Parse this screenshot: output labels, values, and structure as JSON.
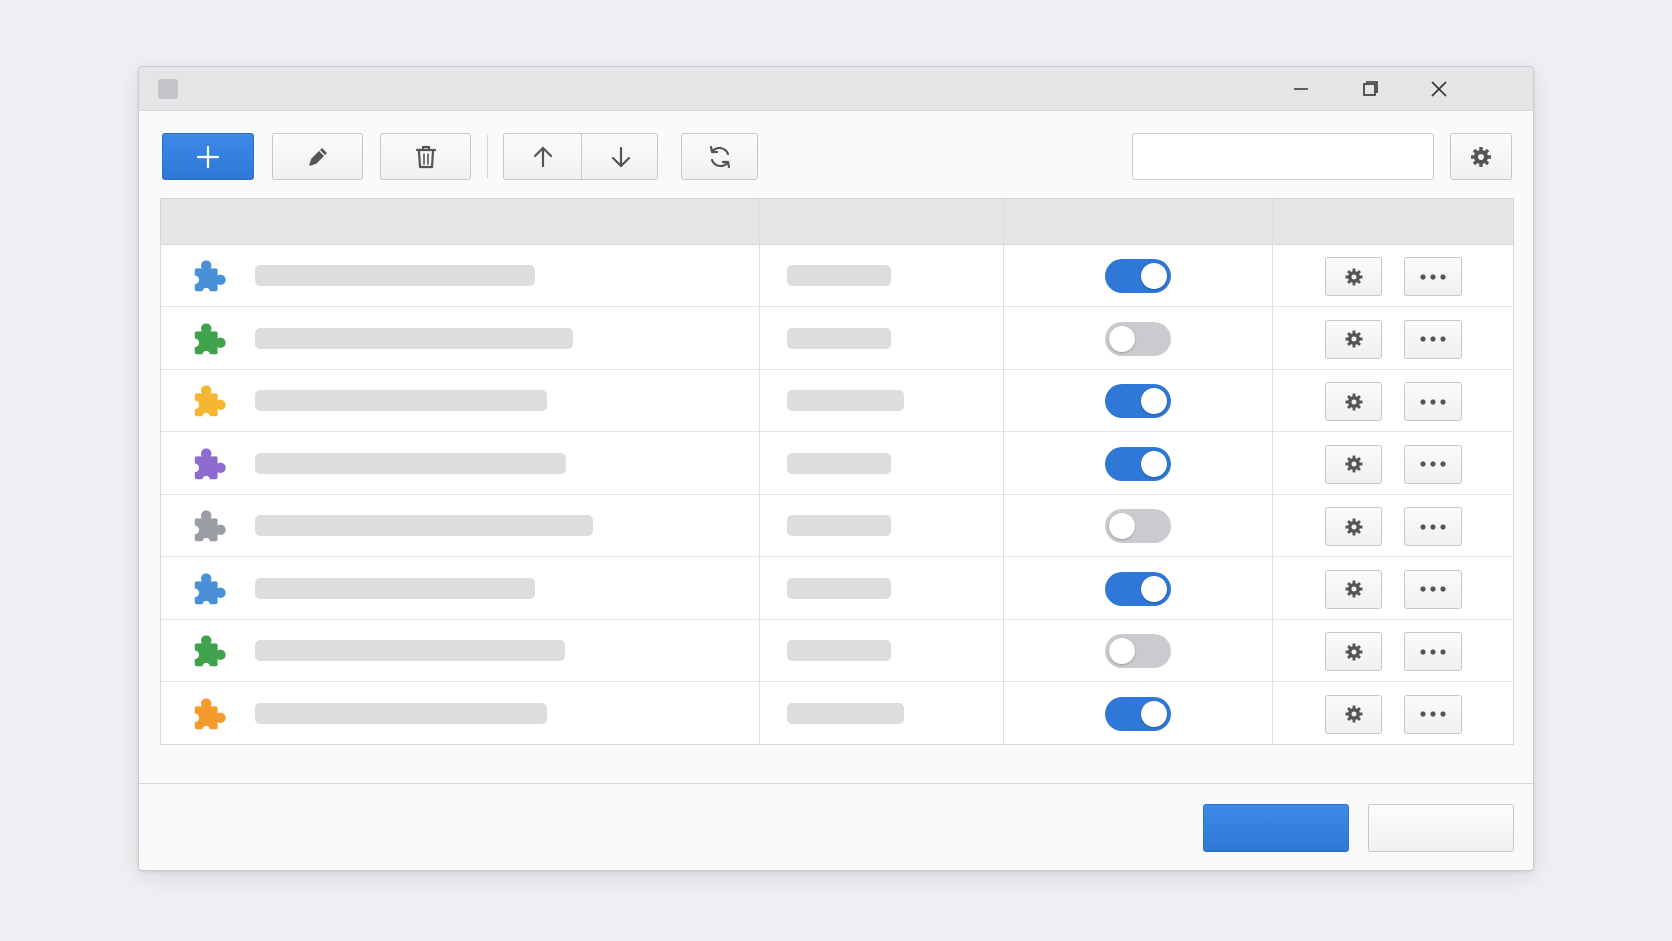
{
  "window": {
    "title": ""
  },
  "toolbar": {
    "search": {
      "value": "",
      "placeholder": ""
    }
  },
  "table": {
    "columns": [
      "",
      "",
      "",
      ""
    ],
    "rows": [
      {
        "icon": "puzzle-icon",
        "icon_color": "#4a90d9",
        "enabled": true
      },
      {
        "icon": "puzzle-icon",
        "icon_color": "#3fa34d",
        "enabled": false
      },
      {
        "icon": "puzzle-icon",
        "icon_color": "#f5b731",
        "enabled": true
      },
      {
        "icon": "puzzle-icon",
        "icon_color": "#8e6bd1",
        "enabled": true
      },
      {
        "icon": "puzzle-icon",
        "icon_color": "#9a9ea4",
        "enabled": false
      },
      {
        "icon": "puzzle-icon",
        "icon_color": "#4a90d9",
        "enabled": true
      },
      {
        "icon": "puzzle-icon",
        "icon_color": "#3fa34d",
        "enabled": false
      },
      {
        "icon": "puzzle-icon",
        "icon_color": "#f39a2b",
        "enabled": true
      }
    ]
  },
  "footer": {
    "ok_label": "",
    "cancel_label": ""
  },
  "colors": {
    "accent": "#2f78d8",
    "toggle_off": "#c9cbcf",
    "placeholder": "#dcdddf"
  }
}
